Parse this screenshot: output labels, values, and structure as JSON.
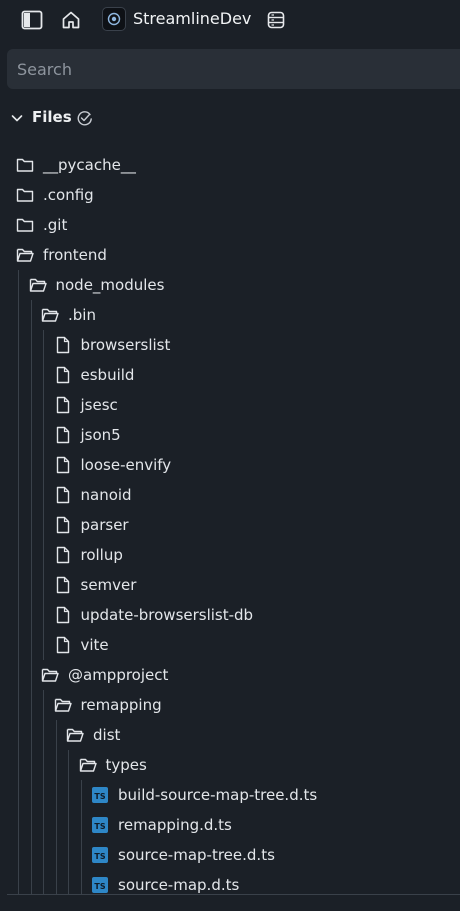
{
  "topbar": {
    "app_title": "StreamlineDev",
    "icons": [
      "sidebar-toggle-icon",
      "home-icon",
      "app-logo-icon",
      "database-icon"
    ]
  },
  "search": {
    "placeholder": "Search",
    "value": ""
  },
  "files_panel": {
    "title": "Files",
    "expanded": true
  },
  "tree": [
    {
      "label": "__pycache__",
      "type": "folder",
      "open": false,
      "depth": 0
    },
    {
      "label": ".config",
      "type": "folder",
      "open": false,
      "depth": 0
    },
    {
      "label": ".git",
      "type": "folder",
      "open": false,
      "depth": 0
    },
    {
      "label": "frontend",
      "type": "folder",
      "open": true,
      "depth": 0
    },
    {
      "label": "node_modules",
      "type": "folder",
      "open": true,
      "depth": 1
    },
    {
      "label": ".bin",
      "type": "folder",
      "open": true,
      "depth": 2
    },
    {
      "label": "browserslist",
      "type": "file",
      "depth": 3
    },
    {
      "label": "esbuild",
      "type": "file",
      "depth": 3
    },
    {
      "label": "jsesc",
      "type": "file",
      "depth": 3
    },
    {
      "label": "json5",
      "type": "file",
      "depth": 3
    },
    {
      "label": "loose-envify",
      "type": "file",
      "depth": 3
    },
    {
      "label": "nanoid",
      "type": "file",
      "depth": 3
    },
    {
      "label": "parser",
      "type": "file",
      "depth": 3
    },
    {
      "label": "rollup",
      "type": "file",
      "depth": 3
    },
    {
      "label": "semver",
      "type": "file",
      "depth": 3
    },
    {
      "label": "update-browserslist-db",
      "type": "file",
      "depth": 3
    },
    {
      "label": "vite",
      "type": "file",
      "depth": 3
    },
    {
      "label": "@ampproject",
      "type": "folder",
      "open": true,
      "depth": 2
    },
    {
      "label": "remapping",
      "type": "folder",
      "open": true,
      "depth": 3
    },
    {
      "label": "dist",
      "type": "folder",
      "open": true,
      "depth": 4
    },
    {
      "label": "types",
      "type": "folder",
      "open": true,
      "depth": 5
    },
    {
      "label": "build-source-map-tree.d.ts",
      "type": "ts",
      "depth": 6
    },
    {
      "label": "remapping.d.ts",
      "type": "ts",
      "depth": 6
    },
    {
      "label": "source-map-tree.d.ts",
      "type": "ts",
      "depth": 6
    },
    {
      "label": "source-map.d.ts",
      "type": "ts",
      "depth": 6
    }
  ],
  "colors": {
    "background": "#1b2027",
    "search_bg": "#292f37",
    "ts_badge": "#2e87c7",
    "guide": "#3a414a"
  }
}
